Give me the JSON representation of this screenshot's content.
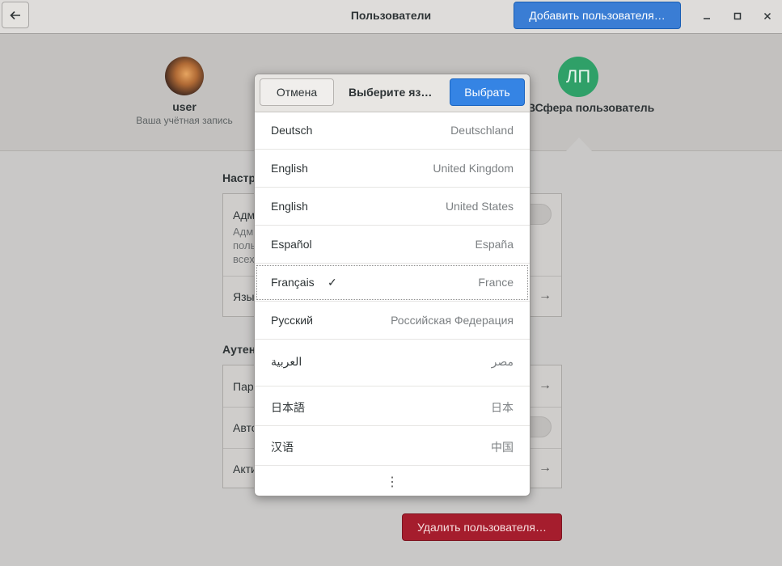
{
  "header": {
    "title": "Пользователи",
    "add_user_label": "Добавить пользователя…"
  },
  "users": {
    "current": {
      "name": "user",
      "subtitle": "Ваша учётная запись"
    },
    "other": {
      "initials": "ЛП",
      "name": "ВСфера пользователь"
    }
  },
  "settings": {
    "section1_label": "Настр",
    "admin_label": "Адм",
    "admin_desc_lines": [
      "Адм",
      "польз",
      "всех"
    ],
    "language_label": "Язы",
    "section2_label": "Аутен",
    "password_label": "Пар",
    "autologin_label": "Авто",
    "activity_label": "Акти",
    "delete_label": "Удалить пользователя…"
  },
  "dialog": {
    "cancel_label": "Отмена",
    "title": "Выберите язык",
    "select_label": "Выбрать",
    "languages": [
      {
        "name": "Deutsch",
        "region": "Deutschland"
      },
      {
        "name": "English",
        "region": "United Kingdom"
      },
      {
        "name": "English",
        "region": "United States"
      },
      {
        "name": "Español",
        "region": "España"
      },
      {
        "name": "Français",
        "region": "France",
        "checkmark": "✓"
      },
      {
        "name": "Русский",
        "region": "Российская Федерация"
      },
      {
        "name": "العربية",
        "region": "مصر"
      },
      {
        "name": "日本語",
        "region": "日本"
      },
      {
        "name": "汉语",
        "region": "中国"
      }
    ],
    "more_glyph": "⋮"
  },
  "colors": {
    "accent": "#3584e4",
    "destructive": "#a51d2d",
    "avatar_green": "#2fa068"
  }
}
